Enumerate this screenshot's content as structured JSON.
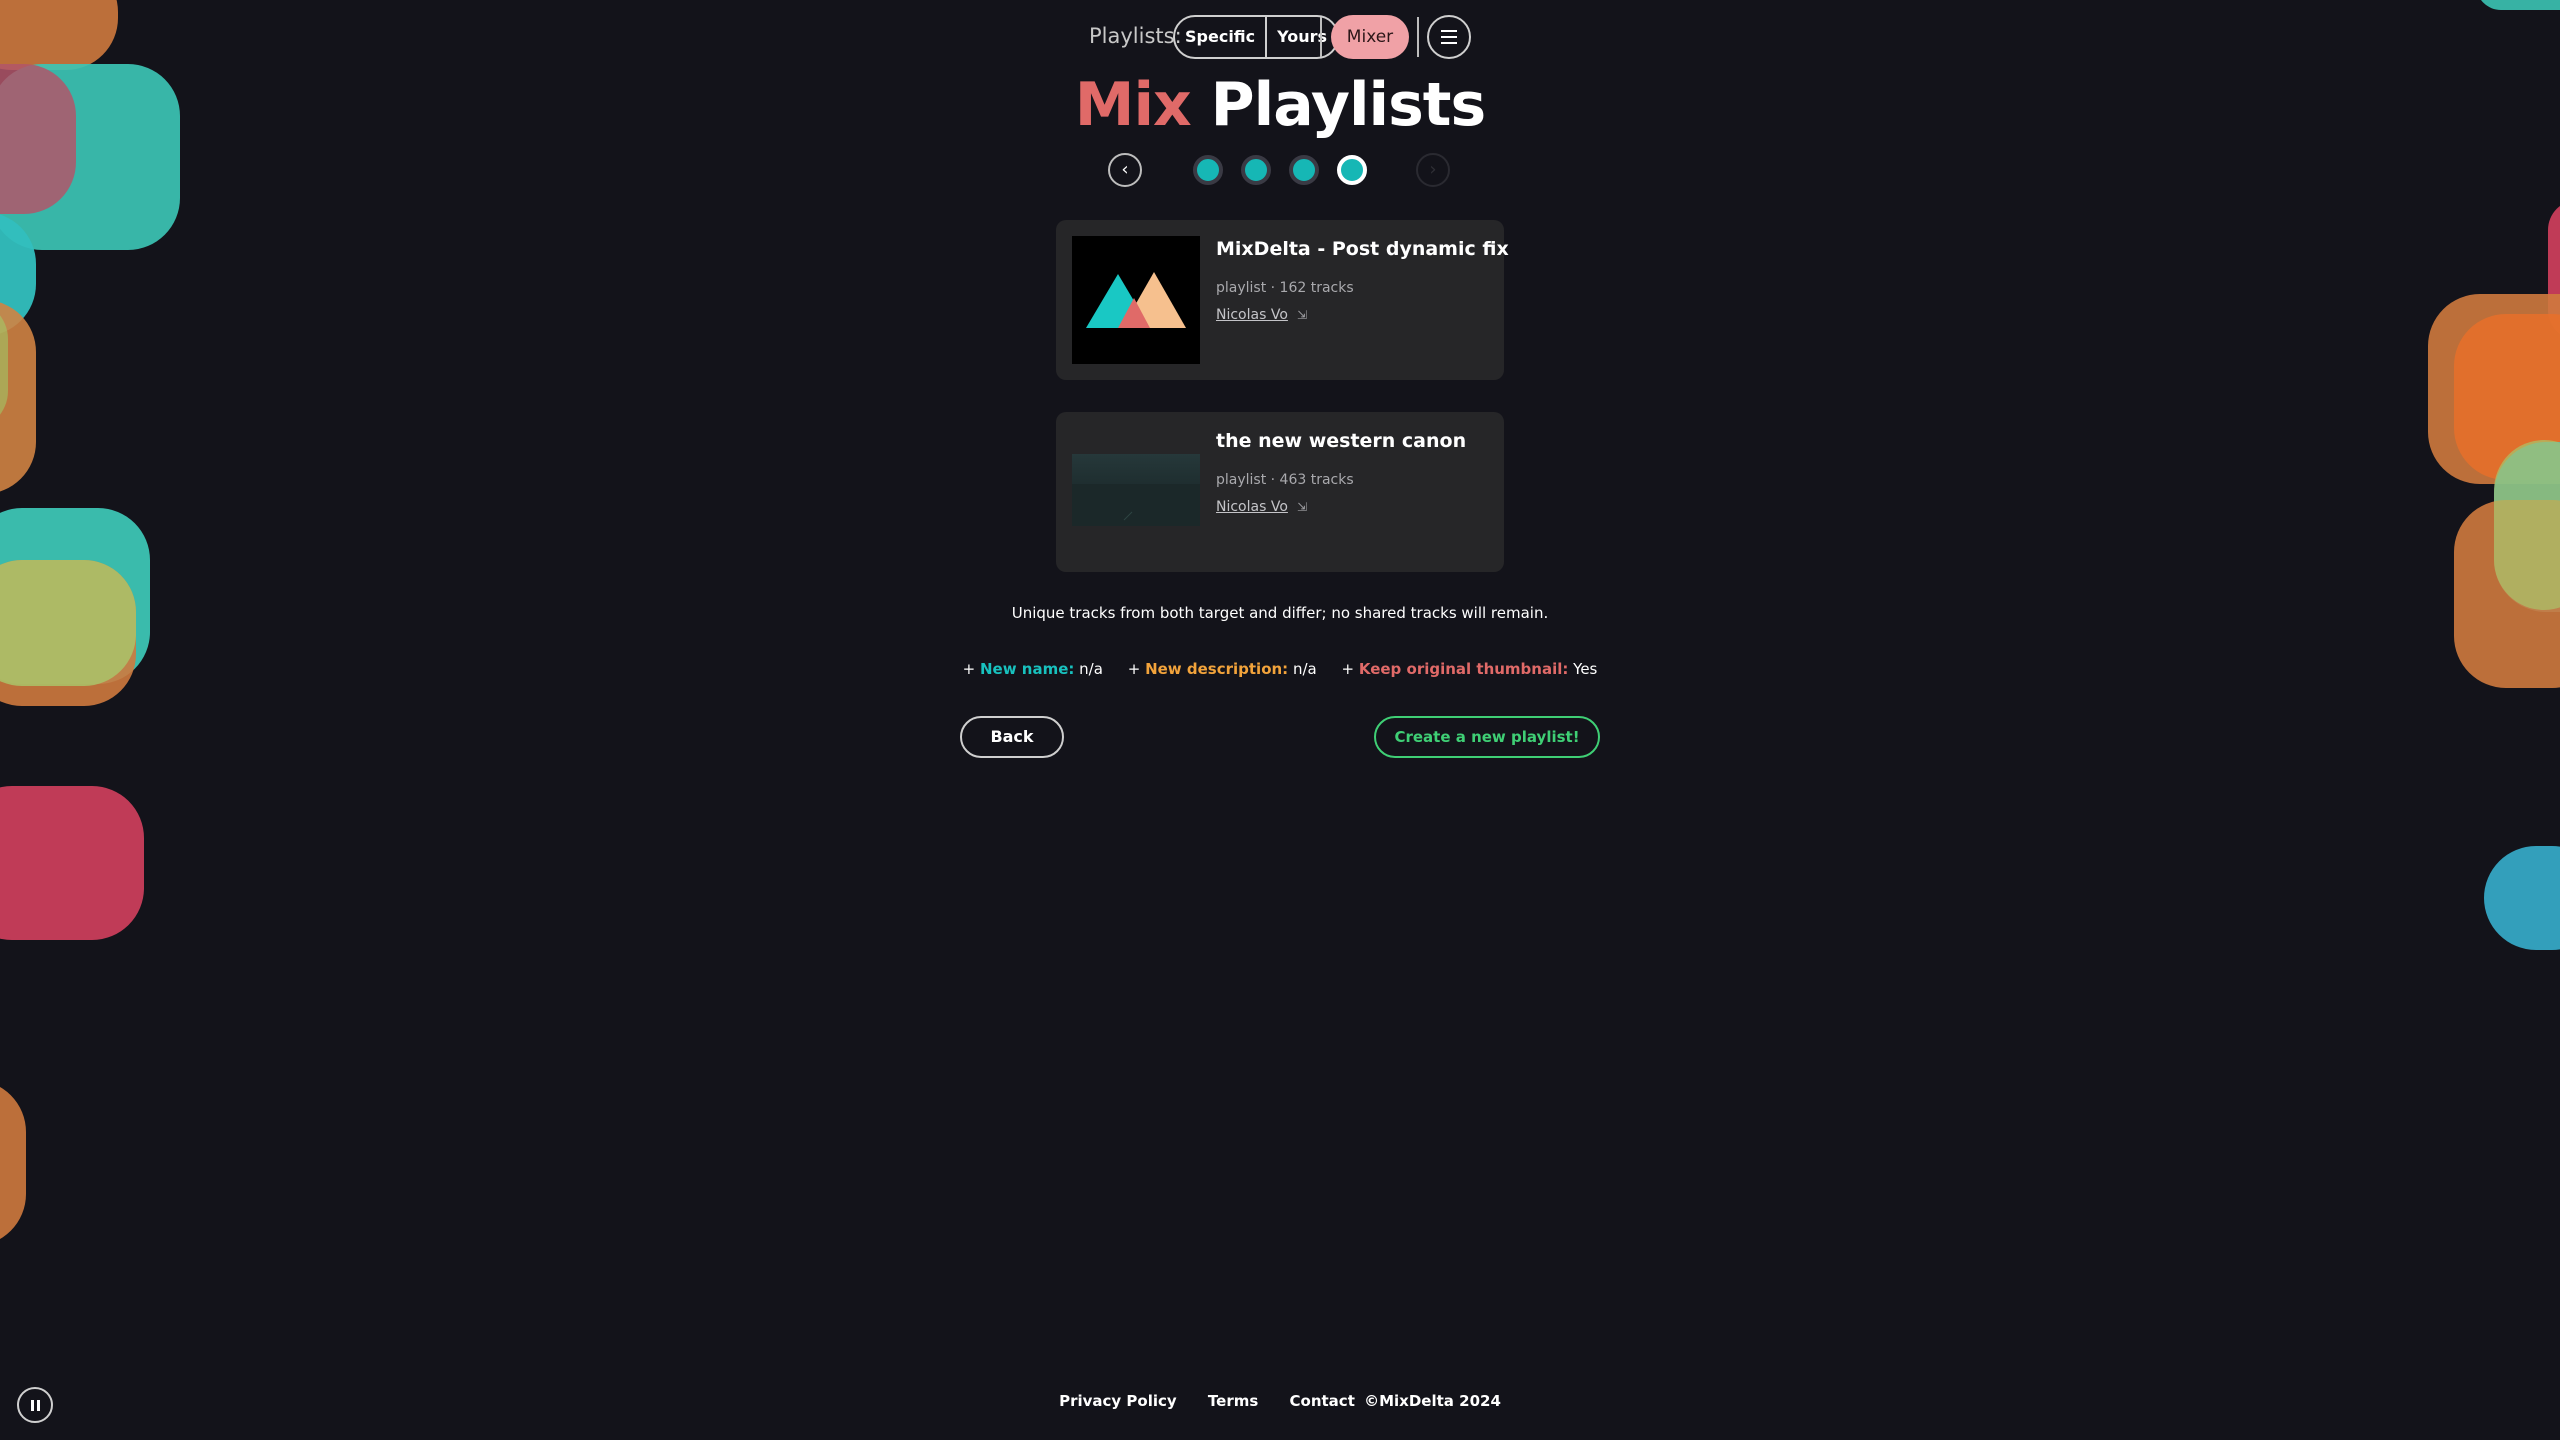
{
  "nav": {
    "label": "Playlists:",
    "specific": "Specific",
    "yours": "Yours",
    "mixer": "Mixer"
  },
  "title": {
    "word1": "Mix",
    "word2": "Playlists"
  },
  "stepper": {
    "prev": "‹",
    "next": "›",
    "steps": 4,
    "current": 4
  },
  "playlists": [
    {
      "title": "MixDelta - Post dynamic fix",
      "meta": "playlist · 162 tracks",
      "owner": "Nicolas Vo"
    },
    {
      "title": "the new western canon",
      "meta": "playlist · 463 tracks",
      "owner": "Nicolas Vo"
    }
  ],
  "summary": "Unique tracks from both target and differ; no shared tracks will remain.",
  "options": {
    "name_label": "New name:",
    "name_value": "n/a",
    "desc_label": "New description:",
    "desc_value": "n/a",
    "thumb_label": "Keep original thumbnail:",
    "thumb_value": "Yes"
  },
  "actions": {
    "back": "Back",
    "create": "Create a new playlist!"
  },
  "footer": {
    "privacy": "Privacy Policy",
    "terms": "Terms",
    "contact": "Contact",
    "copyright": "©MixDelta 2024"
  },
  "colors": {
    "background": "#13131a",
    "accent_teal": "#18c1be",
    "accent_orange": "#f2a33b",
    "accent_red": "#e06a68",
    "accent_green": "#3fcf75",
    "mixer_pink": "#f0a1a6"
  },
  "icons": {
    "menu": "hamburger-icon",
    "external": "external-link-icon",
    "pause": "pause-icon"
  }
}
